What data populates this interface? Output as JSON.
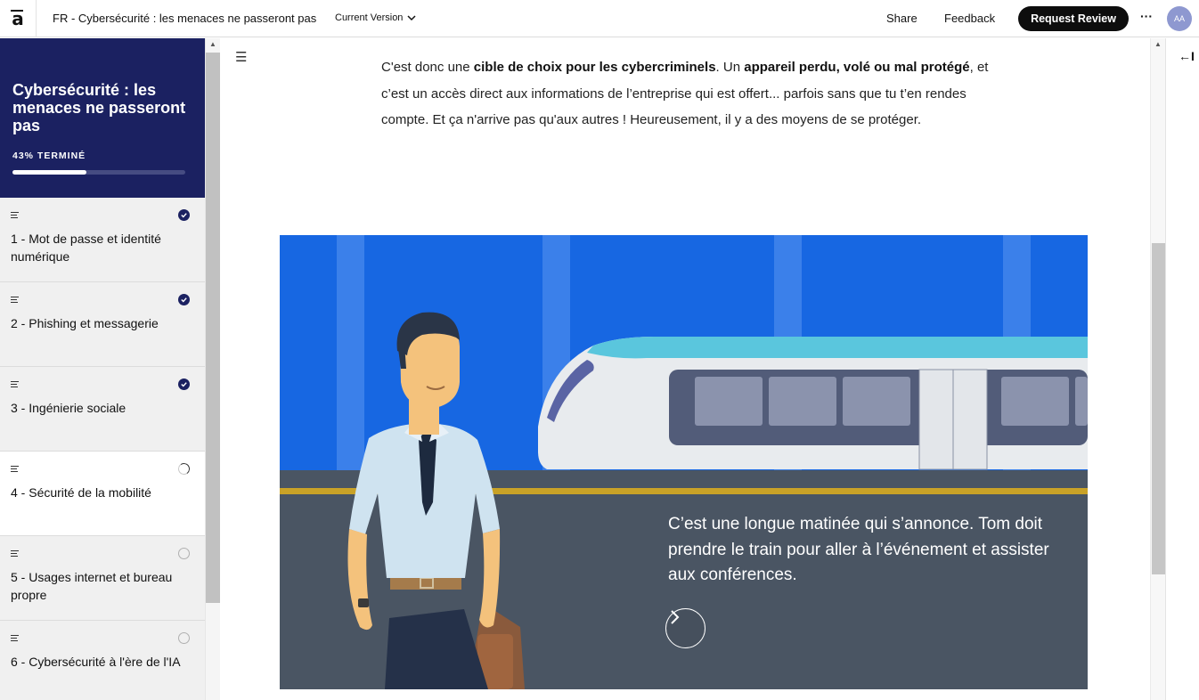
{
  "topbar": {
    "logo": "a",
    "course_title": "FR - Cybersécurité : les menaces ne passeront pas",
    "version_label": "Current Version",
    "share_label": "Share",
    "feedback_label": "Feedback",
    "request_review_label": "Request Review",
    "more_label": "···",
    "avatar_initials": "AA",
    "colors": {
      "review_button": "#0d0d0d",
      "avatar": "#8e98d0"
    }
  },
  "sidebar": {
    "title": "Cybersécurité : les menaces ne passeront pas",
    "progress_label": "43% TERMINÉ",
    "progress_fraction": 0.43,
    "header_color": "#1b2161",
    "items": [
      {
        "label": "1 - Mot de passe et identité numérique",
        "status": "done"
      },
      {
        "label": "2 - Phishing et messagerie",
        "status": "done"
      },
      {
        "label": "3 - Ingénierie sociale",
        "status": "done"
      },
      {
        "label": "4 - Sécurité de la mobilité",
        "status": "in-progress"
      },
      {
        "label": "5 - Usages internet et bureau propre",
        "status": "todo"
      },
      {
        "label": "6 - Cybersécurité à l'ère de l'IA",
        "status": "todo"
      }
    ]
  },
  "main": {
    "paragraph": {
      "p1": "C'est donc une ",
      "b1": "cible de choix pour les cybercriminels",
      "p2": ". Un ",
      "b2": "appareil perdu, volé ou mal protégé",
      "p3": ", et c’est un accès direct aux informations de l’entreprise qui est offert... parfois sans que tu t’en rendes compte. Et ça n'arrive pas qu'aux autres ! Heureusement, il y a des moyens de se protéger."
    },
    "scene": {
      "caption": "C’est une longue matinée qui s’annonce. Tom doit prendre le train pour aller à l’événement et assister aux conférences.",
      "next_icon": "chevron-right-icon",
      "colors": {
        "sky": "#1767e2",
        "platform": "#4a5563",
        "stripe": "#c9a227"
      }
    }
  },
  "right_panel": {
    "collapse_icon": "←I"
  }
}
